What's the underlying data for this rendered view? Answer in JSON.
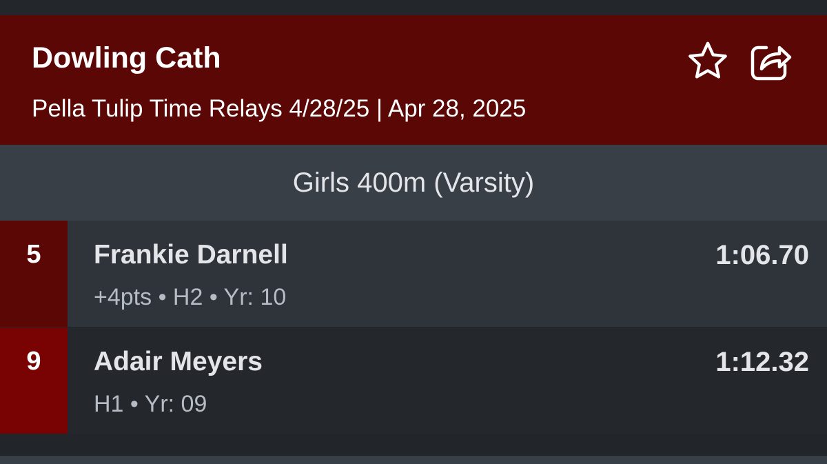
{
  "header": {
    "team_name": "Dowling Cath",
    "meet_info": "Pella Tulip Time Relays 4/28/25 | Apr 28, 2025",
    "background_color": "#5a0705",
    "icons": [
      "star-icon",
      "share-icon"
    ]
  },
  "event": {
    "title": "Girls 400m (Varsity)"
  },
  "results": [
    {
      "place": "5",
      "name": "Frankie Darnell",
      "meta": "+4pts • H2 • Yr: 10",
      "time": "1:06.70",
      "place_color": "#5a0705"
    },
    {
      "place": "9",
      "name": "Adair Meyers",
      "meta": "H1 • Yr: 09",
      "time": "1:12.32",
      "place_color": "#790203"
    }
  ]
}
